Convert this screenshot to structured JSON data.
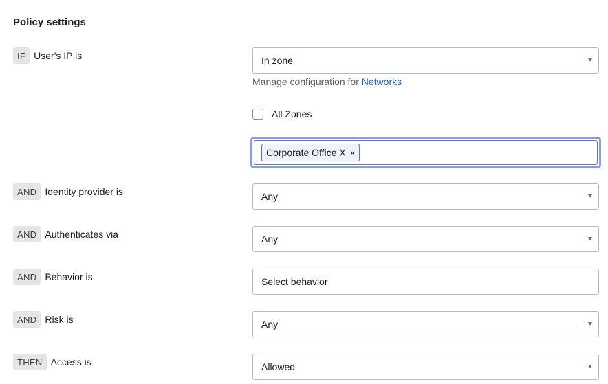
{
  "title": "Policy settings",
  "rows": [
    {
      "tag": "IF",
      "label": "User's IP is",
      "value": "In zone",
      "dropdown": true
    },
    {
      "tag": "AND",
      "label": "Identity provider is",
      "value": "Any",
      "dropdown": true
    },
    {
      "tag": "AND",
      "label": "Authenticates via",
      "value": "Any",
      "dropdown": true
    },
    {
      "tag": "AND",
      "label": "Behavior is",
      "value": "Select behavior",
      "dropdown": false
    },
    {
      "tag": "AND",
      "label": "Risk is",
      "value": "Any",
      "dropdown": true
    },
    {
      "tag": "THEN",
      "label": "Access is",
      "value": "Allowed",
      "dropdown": true
    }
  ],
  "manage": {
    "prefix": "Manage configuration for",
    "link": "Networks"
  },
  "all_zones": {
    "label": "All Zones",
    "checked": false
  },
  "zones": {
    "chips": [
      {
        "label": "Corporate Office X",
        "remove": "×"
      }
    ]
  },
  "colors": {
    "link": "#1662dd",
    "focus": "#8b9de0",
    "chip_bg": "#eef3ff",
    "tag_bg": "#e5e5e6"
  }
}
